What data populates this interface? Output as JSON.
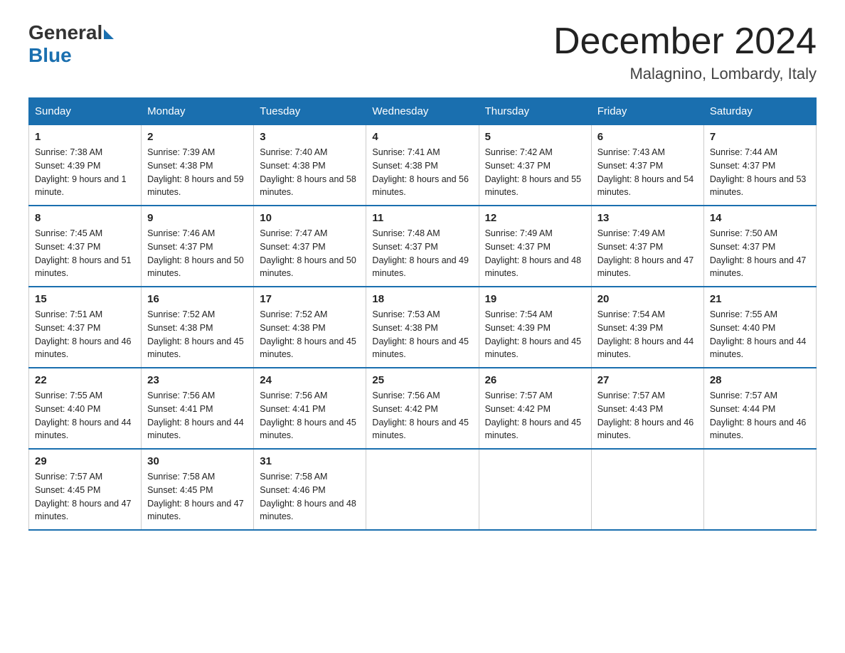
{
  "logo": {
    "general": "General",
    "blue": "Blue"
  },
  "title": "December 2024",
  "location": "Malagnino, Lombardy, Italy",
  "headers": [
    "Sunday",
    "Monday",
    "Tuesday",
    "Wednesday",
    "Thursday",
    "Friday",
    "Saturday"
  ],
  "weeks": [
    [
      {
        "day": "1",
        "sunrise": "7:38 AM",
        "sunset": "4:39 PM",
        "daylight": "9 hours and 1 minute."
      },
      {
        "day": "2",
        "sunrise": "7:39 AM",
        "sunset": "4:38 PM",
        "daylight": "8 hours and 59 minutes."
      },
      {
        "day": "3",
        "sunrise": "7:40 AM",
        "sunset": "4:38 PM",
        "daylight": "8 hours and 58 minutes."
      },
      {
        "day": "4",
        "sunrise": "7:41 AM",
        "sunset": "4:38 PM",
        "daylight": "8 hours and 56 minutes."
      },
      {
        "day": "5",
        "sunrise": "7:42 AM",
        "sunset": "4:37 PM",
        "daylight": "8 hours and 55 minutes."
      },
      {
        "day": "6",
        "sunrise": "7:43 AM",
        "sunset": "4:37 PM",
        "daylight": "8 hours and 54 minutes."
      },
      {
        "day": "7",
        "sunrise": "7:44 AM",
        "sunset": "4:37 PM",
        "daylight": "8 hours and 53 minutes."
      }
    ],
    [
      {
        "day": "8",
        "sunrise": "7:45 AM",
        "sunset": "4:37 PM",
        "daylight": "8 hours and 51 minutes."
      },
      {
        "day": "9",
        "sunrise": "7:46 AM",
        "sunset": "4:37 PM",
        "daylight": "8 hours and 50 minutes."
      },
      {
        "day": "10",
        "sunrise": "7:47 AM",
        "sunset": "4:37 PM",
        "daylight": "8 hours and 50 minutes."
      },
      {
        "day": "11",
        "sunrise": "7:48 AM",
        "sunset": "4:37 PM",
        "daylight": "8 hours and 49 minutes."
      },
      {
        "day": "12",
        "sunrise": "7:49 AM",
        "sunset": "4:37 PM",
        "daylight": "8 hours and 48 minutes."
      },
      {
        "day": "13",
        "sunrise": "7:49 AM",
        "sunset": "4:37 PM",
        "daylight": "8 hours and 47 minutes."
      },
      {
        "day": "14",
        "sunrise": "7:50 AM",
        "sunset": "4:37 PM",
        "daylight": "8 hours and 47 minutes."
      }
    ],
    [
      {
        "day": "15",
        "sunrise": "7:51 AM",
        "sunset": "4:37 PM",
        "daylight": "8 hours and 46 minutes."
      },
      {
        "day": "16",
        "sunrise": "7:52 AM",
        "sunset": "4:38 PM",
        "daylight": "8 hours and 45 minutes."
      },
      {
        "day": "17",
        "sunrise": "7:52 AM",
        "sunset": "4:38 PM",
        "daylight": "8 hours and 45 minutes."
      },
      {
        "day": "18",
        "sunrise": "7:53 AM",
        "sunset": "4:38 PM",
        "daylight": "8 hours and 45 minutes."
      },
      {
        "day": "19",
        "sunrise": "7:54 AM",
        "sunset": "4:39 PM",
        "daylight": "8 hours and 45 minutes."
      },
      {
        "day": "20",
        "sunrise": "7:54 AM",
        "sunset": "4:39 PM",
        "daylight": "8 hours and 44 minutes."
      },
      {
        "day": "21",
        "sunrise": "7:55 AM",
        "sunset": "4:40 PM",
        "daylight": "8 hours and 44 minutes."
      }
    ],
    [
      {
        "day": "22",
        "sunrise": "7:55 AM",
        "sunset": "4:40 PM",
        "daylight": "8 hours and 44 minutes."
      },
      {
        "day": "23",
        "sunrise": "7:56 AM",
        "sunset": "4:41 PM",
        "daylight": "8 hours and 44 minutes."
      },
      {
        "day": "24",
        "sunrise": "7:56 AM",
        "sunset": "4:41 PM",
        "daylight": "8 hours and 45 minutes."
      },
      {
        "day": "25",
        "sunrise": "7:56 AM",
        "sunset": "4:42 PM",
        "daylight": "8 hours and 45 minutes."
      },
      {
        "day": "26",
        "sunrise": "7:57 AM",
        "sunset": "4:42 PM",
        "daylight": "8 hours and 45 minutes."
      },
      {
        "day": "27",
        "sunrise": "7:57 AM",
        "sunset": "4:43 PM",
        "daylight": "8 hours and 46 minutes."
      },
      {
        "day": "28",
        "sunrise": "7:57 AM",
        "sunset": "4:44 PM",
        "daylight": "8 hours and 46 minutes."
      }
    ],
    [
      {
        "day": "29",
        "sunrise": "7:57 AM",
        "sunset": "4:45 PM",
        "daylight": "8 hours and 47 minutes."
      },
      {
        "day": "30",
        "sunrise": "7:58 AM",
        "sunset": "4:45 PM",
        "daylight": "8 hours and 47 minutes."
      },
      {
        "day": "31",
        "sunrise": "7:58 AM",
        "sunset": "4:46 PM",
        "daylight": "8 hours and 48 minutes."
      },
      null,
      null,
      null,
      null
    ]
  ]
}
